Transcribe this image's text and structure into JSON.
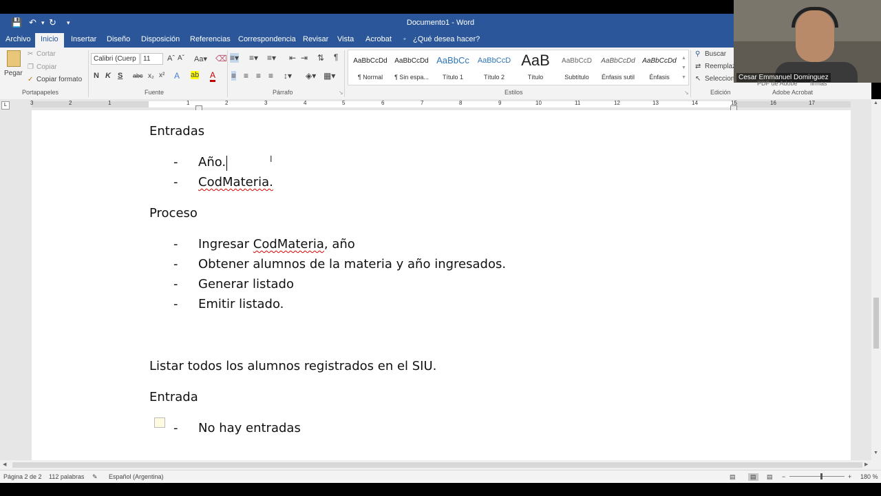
{
  "window": {
    "title": "Documento1 - Word"
  },
  "quick_access": {
    "save_icon": "save-icon",
    "undo_icon": "undo-icon",
    "redo_icon": "redo-icon"
  },
  "tabs": [
    "Archivo",
    "Inicio",
    "Insertar",
    "Diseño",
    "Disposición",
    "Referencias",
    "Correspondencia",
    "Revisar",
    "Vista",
    "Acrobat"
  ],
  "tell_me": "¿Qué desea hacer?",
  "clipboard": {
    "paste": "Pegar",
    "cut": "Cortar",
    "copy": "Copiar",
    "format_painter": "Copiar formato",
    "group": "Portapapeles"
  },
  "font": {
    "name": "Calibri (Cuerp",
    "size": "11",
    "group": "Fuente"
  },
  "paragraph": {
    "group": "Párrafo"
  },
  "styles": {
    "group": "Estilos",
    "items": [
      {
        "preview": "AaBbCcDd",
        "name": "¶ Normal"
      },
      {
        "preview": "AaBbCcDd",
        "name": "¶ Sin espa..."
      },
      {
        "preview": "AaBbCc",
        "name": "Título 1"
      },
      {
        "preview": "AaBbCcD",
        "name": "Título 2"
      },
      {
        "preview": "AaB",
        "name": "Título"
      },
      {
        "preview": "AaBbCcD",
        "name": "Subtítulo"
      },
      {
        "preview": "AaBbCcDd",
        "name": "Énfasis sutil"
      },
      {
        "preview": "AaBbCcDd",
        "name": "Énfasis"
      }
    ]
  },
  "editing": {
    "find": "Buscar",
    "replace": "Reemplaz",
    "select": "Seleccion",
    "group": "Edición"
  },
  "acrobat": {
    "group": "Adobe Acrobat",
    "pdf": "PDF de Adobe",
    "firmas": "firmas"
  },
  "ruler": {
    "numbers": [
      "3",
      "2",
      "1",
      "1",
      "2",
      "3",
      "4",
      "5",
      "6",
      "7",
      "8",
      "9",
      "10",
      "11",
      "12",
      "13",
      "14",
      "15",
      "16",
      "17"
    ]
  },
  "document": {
    "heading1": "Entradas",
    "list1": [
      "Año.",
      "CodMateria."
    ],
    "heading2": "Proceso",
    "list2": [
      "Ingresar ",
      "CodMateria",
      ", año",
      "Obtener alumnos de la materia y año ingresados.",
      "Generar listado",
      "Emitir listado."
    ],
    "bullet": "-",
    "para": "Listar todos los alumnos registrados en el SIU.",
    "heading3": "Entrada",
    "list3": [
      "No hay entradas"
    ]
  },
  "status": {
    "page": "Página 2 de 2",
    "words": "112 palabras",
    "language": "Español (Argentina)",
    "zoom": "180 %"
  },
  "webcam": {
    "name": "Cesar Emmanuel Dominguez"
  }
}
